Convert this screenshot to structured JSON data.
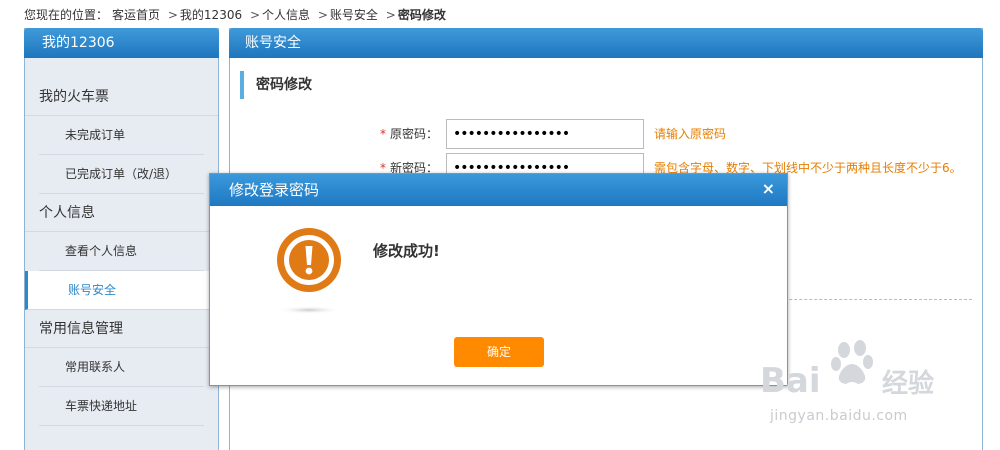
{
  "breadcrumb": {
    "prefix": "您现在的位置：",
    "items": [
      "客运首页",
      "我的12306",
      "个人信息",
      "账号安全"
    ],
    "current": "密码修改",
    "sep": ">"
  },
  "sidebar": {
    "title": "我的12306",
    "groups": [
      {
        "label": "我的火车票"
      },
      {
        "label": "个人信息"
      },
      {
        "label": "常用信息管理"
      }
    ],
    "items": [
      {
        "label": "未完成订单"
      },
      {
        "label": "已完成订单（改/退）"
      },
      {
        "label": "查看个人信息"
      },
      {
        "label": "账号安全"
      },
      {
        "label": "常用联系人"
      },
      {
        "label": "车票快递地址"
      }
    ]
  },
  "main": {
    "title": "账号安全",
    "section_title": "密码修改",
    "fields": [
      {
        "required": "*",
        "label": "原密码：",
        "value": "••••••••••••••••",
        "hint": "请输入原密码"
      },
      {
        "required": "*",
        "label": "新密码：",
        "value": "••••••••••••••••",
        "hint": "需包含字母、数字、下划线中不少于两种且长度不少于6。"
      }
    ]
  },
  "dialog": {
    "title": "修改登录密码",
    "close": "×",
    "message": "修改成功!",
    "confirm": "确定",
    "icon": "exclamation-circle-icon",
    "icon_color": "#e07a14"
  },
  "watermark": {
    "brand": "Baidu经验",
    "url": "jingyan.baidu.com"
  },
  "colors": {
    "header_blue": "#1e76be",
    "accent_orange": "#ff8a00",
    "hint_orange": "#e67e00",
    "required_red": "#e0301e"
  }
}
